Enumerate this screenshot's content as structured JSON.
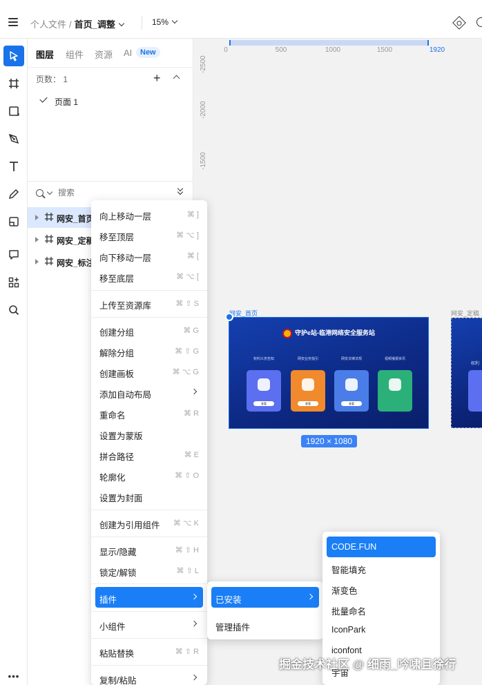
{
  "header": {
    "breadcrumb_root": "个人文件",
    "breadcrumb_sep": "/",
    "document_name": "首页_调整",
    "zoom": "15%"
  },
  "layers_panel": {
    "tabs": [
      "图层",
      "组件",
      "资源",
      "AI"
    ],
    "new_badge": "New",
    "pages_label": "页数： 1",
    "page_name": "页面 1",
    "search_placeholder": "搜索",
    "layers": [
      "网安_首页",
      "网安_定稿",
      "网安_标注"
    ]
  },
  "canvas": {
    "ruler_top": [
      "0",
      "500",
      "1000",
      "1500",
      "1920"
    ],
    "ruler_left": [
      "-2500",
      "-2000",
      "-1500"
    ],
    "frame_label_1": "网安_首页",
    "frame_label_2": "网安_定稿",
    "artboard_title": "守护e站-临港网络安全服务站",
    "artboard_columns": [
      "权利义务告知",
      "网安业务指引",
      "网安法律法规",
      "视频播报资讯"
    ],
    "artboard_button": "查看",
    "artboard_card_colors": [
      "#5b6ff0",
      "#f08a2c",
      "#4b7de8",
      "#2bb07a"
    ],
    "frame2_text": "权利",
    "dimensions": "1920 × 1080"
  },
  "context_menu": {
    "items": [
      {
        "label": "向上移动一层",
        "shortcut": "⌘ ]"
      },
      {
        "label": "移至顶层",
        "shortcut": "⌘ ⌥ ]"
      },
      {
        "label": "向下移动一层",
        "shortcut": "⌘ ["
      },
      {
        "label": "移至底层",
        "shortcut": "⌘ ⌥ ["
      },
      {
        "label": "上传至资源库",
        "shortcut": "⌘ ⇧ S"
      },
      {
        "label": "创建分组",
        "shortcut": "⌘ G"
      },
      {
        "label": "解除分组",
        "shortcut": "⌘ ⇧ G"
      },
      {
        "label": "创建画板",
        "shortcut": "⌘ ⌥ G"
      },
      {
        "label": "添加自动布局",
        "shortcut": ""
      },
      {
        "label": "重命名",
        "shortcut": "⌘ R"
      },
      {
        "label": "设置为蒙版",
        "shortcut": ""
      },
      {
        "label": "拼合路径",
        "shortcut": "⌘ E"
      },
      {
        "label": "轮廓化",
        "shortcut": "⌘ ⇧ O"
      },
      {
        "label": "设置为封面",
        "shortcut": ""
      },
      {
        "label": "创建为引用组件",
        "shortcut": "⌘ ⌥ K"
      },
      {
        "label": "显示/隐藏",
        "shortcut": "⌘ ⇧ H"
      },
      {
        "label": "锁定/解锁",
        "shortcut": "⌘ ⇧ L"
      },
      {
        "label": "插件",
        "shortcut": ""
      },
      {
        "label": "小组件",
        "shortcut": ""
      },
      {
        "label": "粘贴替换",
        "shortcut": "⌘ ⇧ R"
      },
      {
        "label": "复制/粘贴",
        "shortcut": ""
      }
    ]
  },
  "plugins_submenu": {
    "items": [
      "已安装",
      "管理插件"
    ]
  },
  "installed_plugins": {
    "items": [
      "CODE.FUN",
      "智能填充",
      "渐变色",
      "批量命名",
      "IconPark",
      "iconfont",
      "宇宙"
    ]
  },
  "watermark": "掘金技术社区 @ 细雨_吟啸且徐行",
  "colors": {
    "accent": "#1a73e8",
    "menu_highlight": "#1a7ef6",
    "artboard_bg": "#0f2a8a"
  }
}
